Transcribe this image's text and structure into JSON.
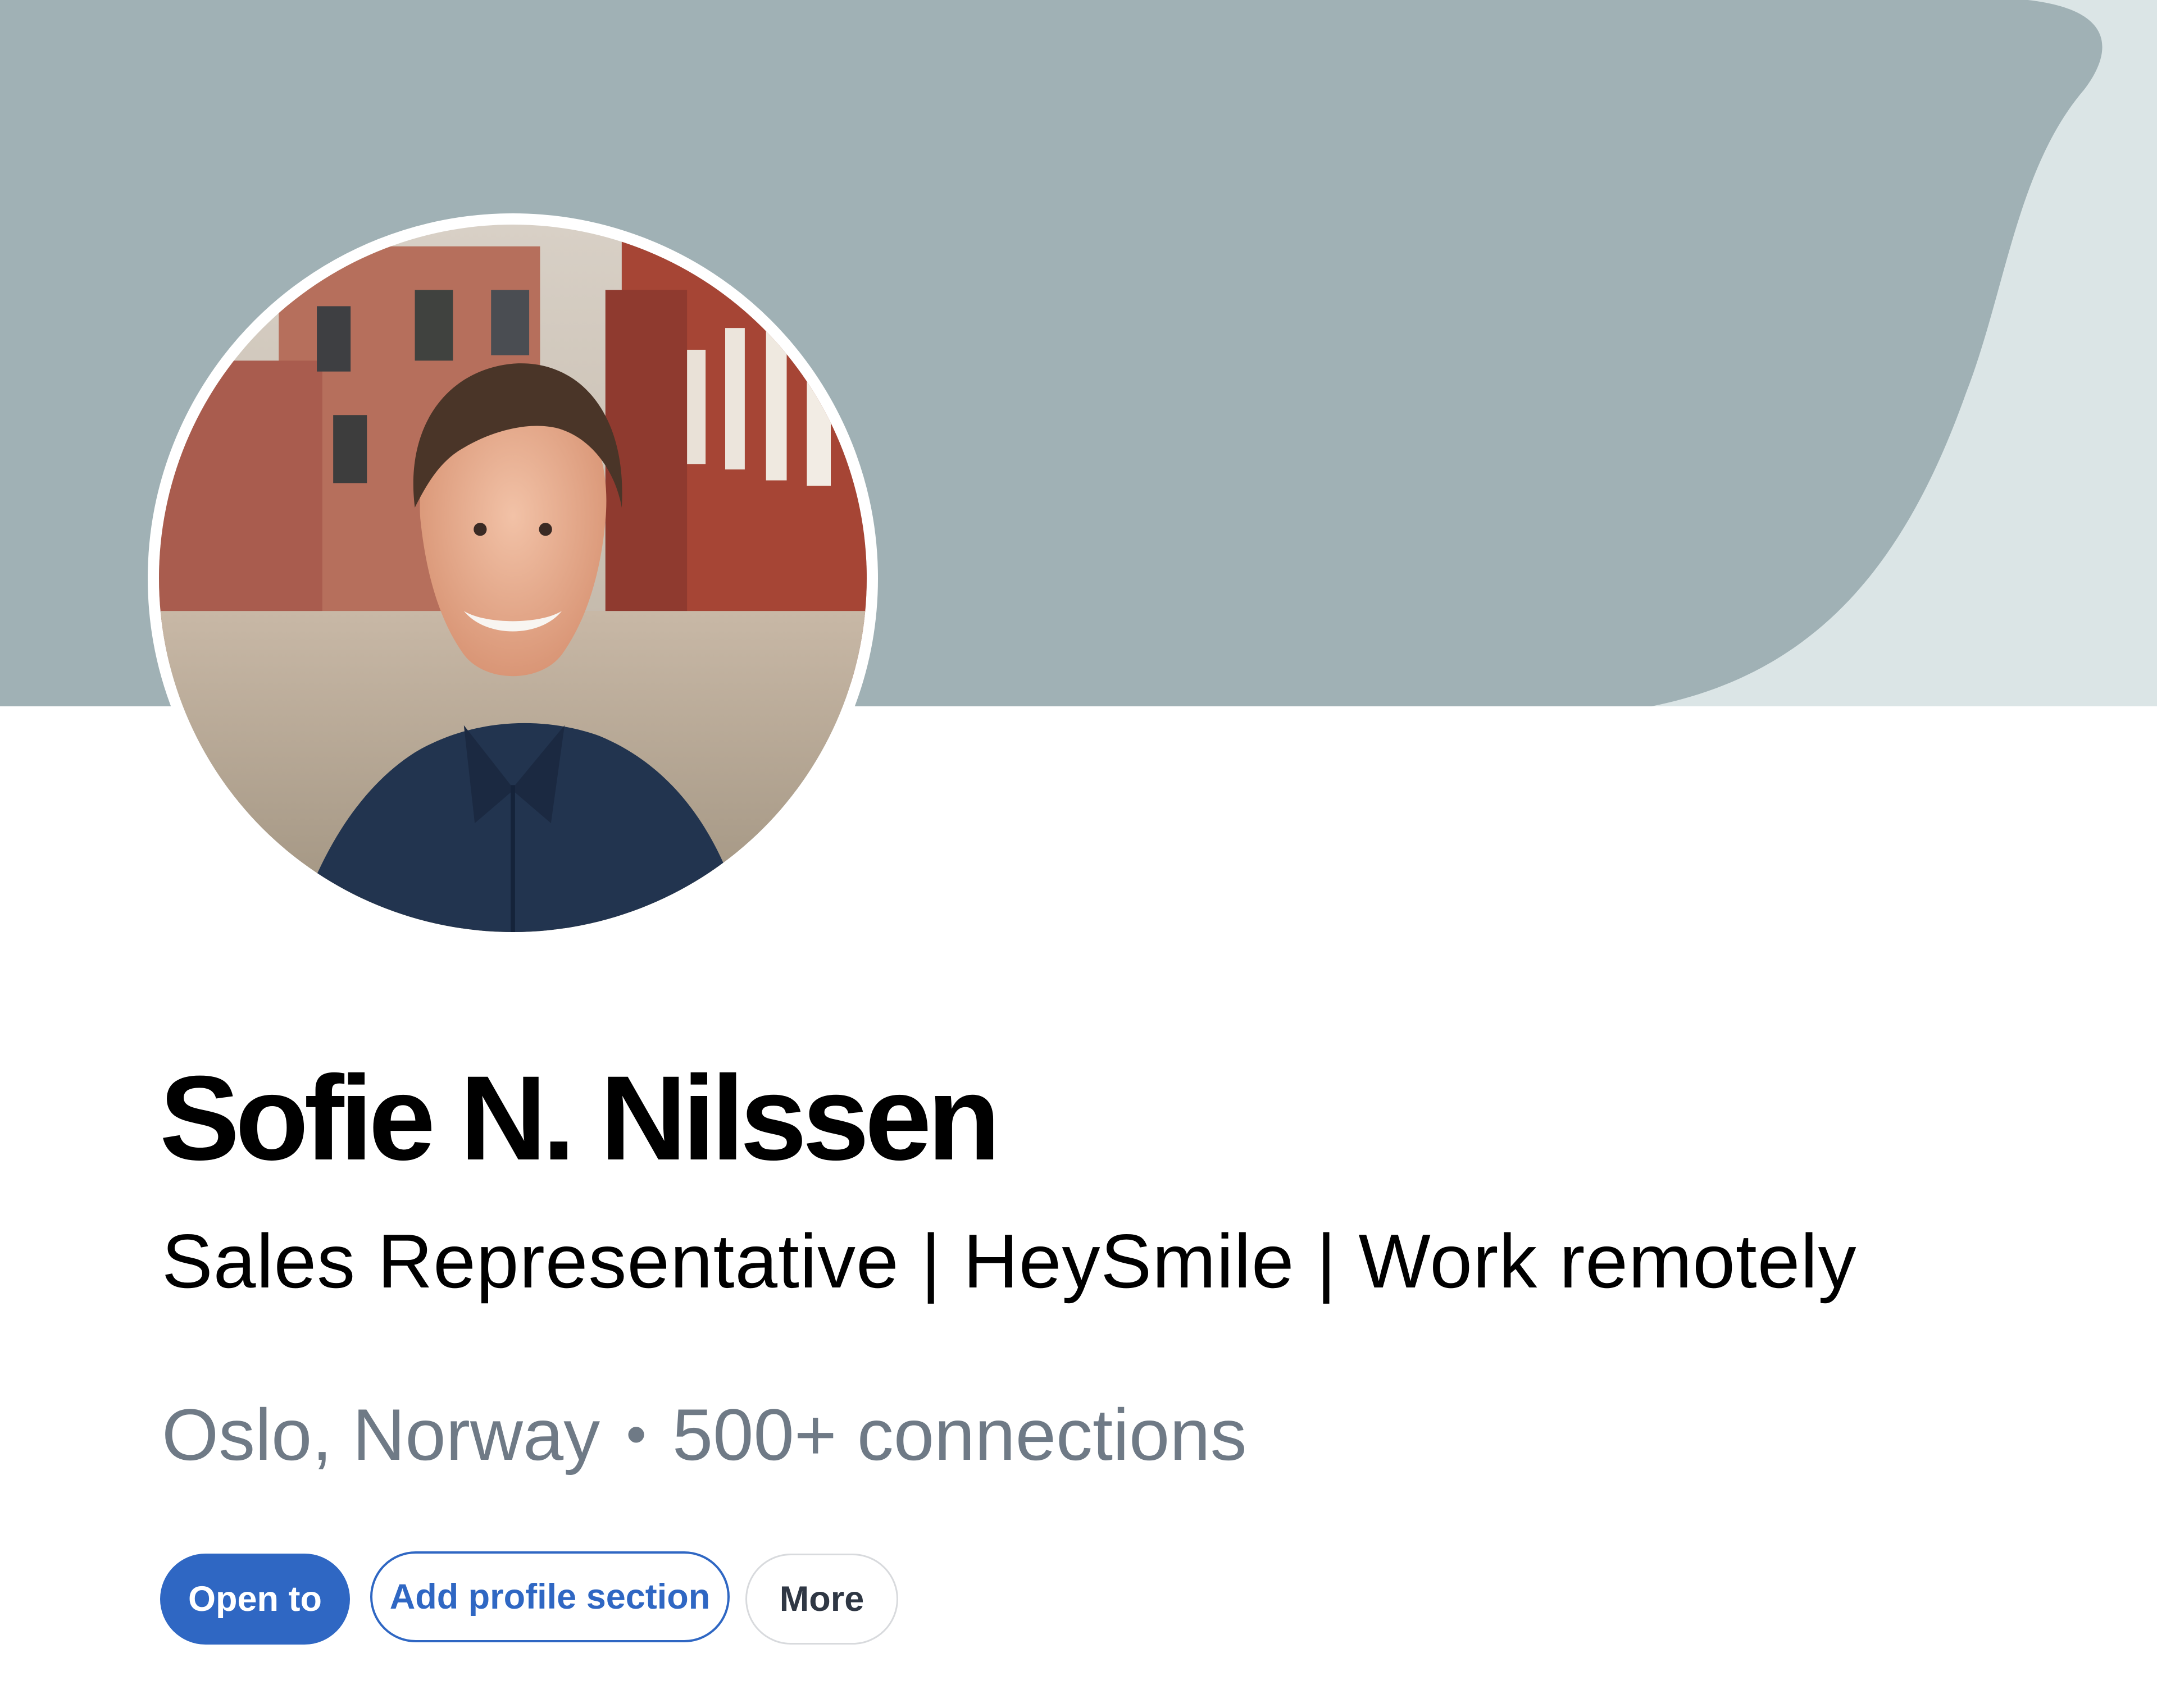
{
  "cover": {
    "primary_color": "#a0b1b5",
    "secondary_color": "#dbe5e6"
  },
  "profile": {
    "avatar_icon": "profile-photo",
    "name": "Sofie N. Nilssen",
    "headline": "Sales Representative | HeySmile | Work remotely",
    "location": "Oslo, Norway",
    "separator": "•",
    "connections": "500+ connections"
  },
  "actions": {
    "open_to": "Open to",
    "add_profile_section": "Add profile section",
    "more": "More"
  },
  "colors": {
    "accent": "#2f67c3",
    "muted_text": "#6f7a86"
  }
}
